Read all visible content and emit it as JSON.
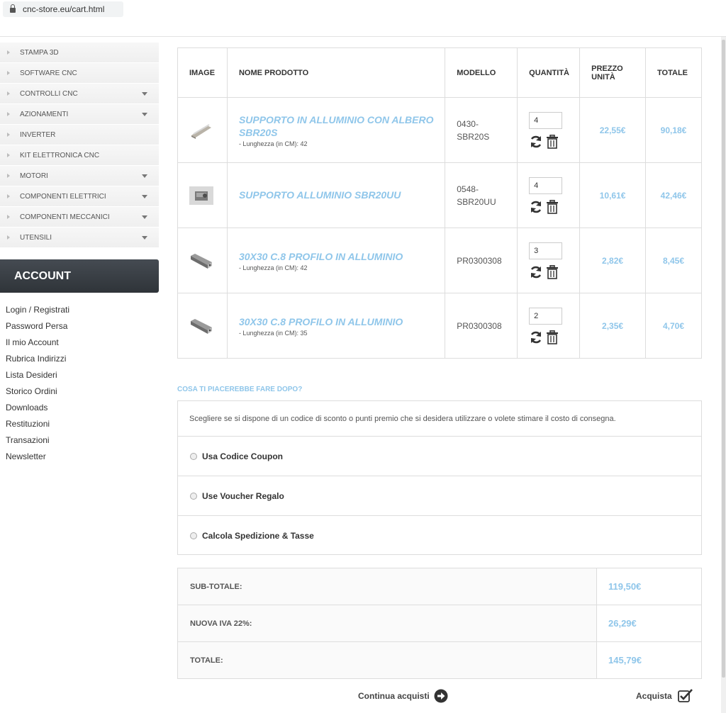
{
  "browser": {
    "url": "cnc-store.eu/cart.html"
  },
  "sidebar": {
    "categories": [
      {
        "label": "STAMPA 3D",
        "has_submenu": false
      },
      {
        "label": "SOFTWARE CNC",
        "has_submenu": false
      },
      {
        "label": "CONTROLLI CNC",
        "has_submenu": true
      },
      {
        "label": "AZIONAMENTI",
        "has_submenu": true
      },
      {
        "label": "INVERTER",
        "has_submenu": false
      },
      {
        "label": "KIT ELETTRONICA CNC",
        "has_submenu": false
      },
      {
        "label": "MOTORI",
        "has_submenu": true
      },
      {
        "label": "COMPONENTI ELETTRICI",
        "has_submenu": true
      },
      {
        "label": "COMPONENTI MECCANICI",
        "has_submenu": true
      },
      {
        "label": "UTENSILI",
        "has_submenu": true
      }
    ],
    "account_title": "ACCOUNT",
    "account_links": [
      "Login / Registrati",
      "Password Persa",
      "Il mio Account",
      "Rubrica Indirizzi",
      "Lista Desideri",
      "Storico Ordini",
      "Downloads",
      "Restituzioni",
      "Transazioni",
      "Newsletter"
    ]
  },
  "cart": {
    "headers": {
      "image": "IMAGE",
      "name": "NOME PRODOTTO",
      "model": "MODELLO",
      "qty": "QUANTITÀ",
      "price_l1": "PREZZO",
      "price_l2": "UNITÀ",
      "total": "TOTALE"
    },
    "rows": [
      {
        "name": "SUPPORTO IN ALLUMINIO CON ALBERO SBR20S",
        "option": "- Lunghezza (in CM): 42",
        "model_l1": "0430-",
        "model_l2": "SBR20S",
        "qty": "4",
        "unit_price": "22,55€",
        "total": "90,18€",
        "thumb": "rail-shaft"
      },
      {
        "name": "SUPPORTO ALLUMINIO SBR20UU",
        "option": "",
        "model_l1": "0548-",
        "model_l2": "SBR20UU",
        "qty": "4",
        "unit_price": "10,61€",
        "total": "42,46€",
        "thumb": "bearing-block"
      },
      {
        "name": "30X30 C.8 PROFILO IN ALLUMINIO",
        "option": "- Lunghezza (in CM): 42",
        "model_l1": "PR0300308",
        "model_l2": "",
        "qty": "3",
        "unit_price": "2,82€",
        "total": "8,45€",
        "thumb": "profile"
      },
      {
        "name": "30X30 C.8 PROFILO IN ALLUMINIO",
        "option": "- Lunghezza (in CM): 35",
        "model_l1": "PR0300308",
        "model_l2": "",
        "qty": "2",
        "unit_price": "2,35€",
        "total": "4,70€",
        "thumb": "profile"
      }
    ]
  },
  "next": {
    "title": "COSA TI PIACEREBBE FARE DOPO?",
    "description": "Scegliere se si dispone di un codice di sconto o punti premio che si desidera utilizzare o volete stimare il costo di consegna.",
    "options": [
      "Usa Codice Coupon",
      "Use Voucher Regalo",
      "Calcola Spedizione & Tasse"
    ]
  },
  "totals": [
    {
      "label": "SUB-TOTALE:",
      "value": "119,50€"
    },
    {
      "label": "NUOVA IVA 22%:",
      "value": "26,29€"
    },
    {
      "label": "TOTALE:",
      "value": "145,79€"
    }
  ],
  "buttons": {
    "continue": "Continua acquisti",
    "buy": "Acquista"
  },
  "colors": {
    "accent": "#8fc6ea",
    "account_header": "#3a3f45"
  }
}
